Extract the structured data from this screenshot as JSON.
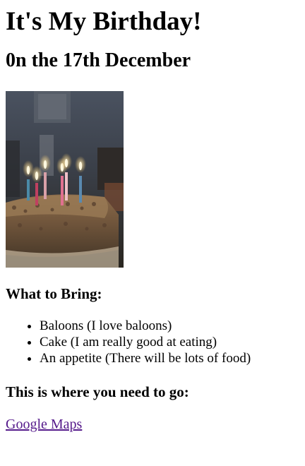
{
  "page": {
    "title": "It's My Birthday!",
    "date_line": "0n the 17th December",
    "image_alt": "Birthday cake with lit candles",
    "bring_heading": "What to Bring:",
    "bring_items": [
      "Baloons (I love baloons)",
      "Cake (I am really good at eating)",
      "An appetite (There will be lots of food)"
    ],
    "location_heading": "This is where you need to go:",
    "map_link": "Google Maps"
  },
  "colors": {
    "link_visited": "#551a8b",
    "text": "#000000",
    "background": "#ffffff"
  }
}
